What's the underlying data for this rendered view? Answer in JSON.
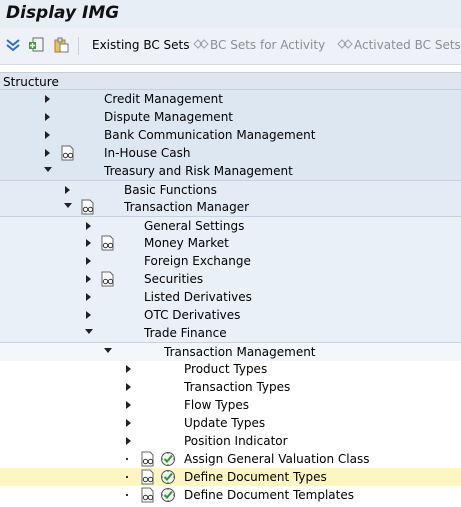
{
  "window": {
    "title": "Display IMG"
  },
  "toolbar": {
    "existing_bc_sets": "Existing BC Sets",
    "bc_sets_for_activity": "BC Sets for Activity",
    "activated_bc_sets": "Activated BC Sets f"
  },
  "structure": {
    "header": "Structure"
  },
  "tree": {
    "credit_management": "Credit Management",
    "dispute_management": "Dispute Management",
    "bank_communication_management": "Bank Communication Management",
    "in_house_cash": "In-House Cash",
    "treasury_risk_management": "Treasury and Risk Management",
    "basic_functions": "Basic Functions",
    "transaction_manager": "Transaction Manager",
    "general_settings": "General Settings",
    "money_market": "Money Market",
    "foreign_exchange": "Foreign Exchange",
    "securities": "Securities",
    "listed_derivatives": "Listed Derivatives",
    "otc_derivatives": "OTC Derivatives",
    "trade_finance": "Trade Finance",
    "transaction_management": "Transaction Management",
    "product_types": "Product Types",
    "transaction_types": "Transaction Types",
    "flow_types": "Flow Types",
    "update_types": "Update Types",
    "position_indicator": "Position Indicator",
    "assign_general_valuation_class": "Assign General Valuation Class",
    "define_document_types": "Define Document Types",
    "define_document_templates": "Define Document Templates"
  }
}
